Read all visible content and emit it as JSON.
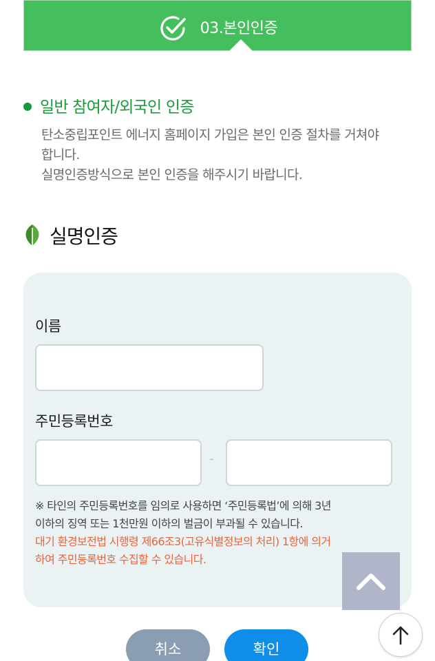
{
  "step": {
    "title": "03.본인인증",
    "icon": "check-circle-icon",
    "color": "#45bf5e"
  },
  "section": {
    "heading": "일반 참여자/외국인 인증",
    "description_line1": "탄소중립포인트 에너지 홈페이지 가입은 본인 인증 절차를 거쳐야",
    "description_line2": "합니다.",
    "description_line3": "실명인증방식으로 본인 인증을 해주시기 바랍니다."
  },
  "verification": {
    "title": "실명인증",
    "title_icon": "leaf-icon",
    "name_label": "이름",
    "name_value": "",
    "rrn_label": "주민등록번호",
    "rrn_front_value": "",
    "rrn_back_value": "",
    "rrn_separator": "-",
    "notice_line1": "※ 타인의 주민등록번호를 임의로 사용하면 ‘주민등록법’에 의해 3년",
    "notice_line2": "이하의 징역 또는 1천만원 이하의 벌금이 부과될 수 있습니다.",
    "legal_line1": "대기 환경보전법 시행령 제66조3(고유식별정보의 처리) 1항에 의거",
    "legal_line2": "하여 주민등록번호 수집할 수 있습니다.",
    "legal_color": "#e8643a"
  },
  "buttons": {
    "cancel_label": "취소",
    "confirm_label": "확인"
  },
  "floating": {
    "scroll_up_icon": "chevron-up-icon",
    "top_icon": "arrow-up-icon"
  }
}
